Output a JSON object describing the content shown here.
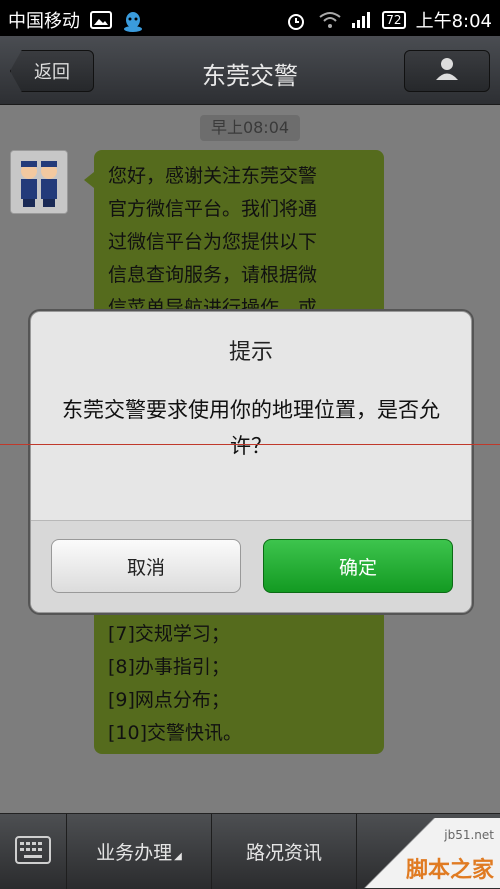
{
  "status_bar": {
    "carrier": "中国移动",
    "icons_left": [
      "image-icon",
      "qq-icon"
    ],
    "icons_right": [
      "alarm-icon",
      "wifi-icon",
      "signal-icon"
    ],
    "battery": "72",
    "time": "上午8:04"
  },
  "title_bar": {
    "back_label": "返回",
    "title": "东莞交警",
    "profile_icon": "person-icon"
  },
  "chat": {
    "timestamp": "早上08:04",
    "message_lines": [
      "您好，感谢关注东莞交警",
      "官方微信平台。我们将通",
      "过微信平台为您提供以下",
      "信息查询服务，请根据微",
      "信菜单导航进行操作，或"
    ],
    "message_tail": [
      "[7]交规学习；",
      "[8]办事指引；",
      "[9]网点分布；",
      "[10]交警快讯。"
    ]
  },
  "dialog": {
    "title": "提示",
    "message": "东莞交警要求使用你的地理位置，是否允许？",
    "cancel_label": "取消",
    "ok_label": "确定",
    "ok_color": "#1fa82c"
  },
  "bottom_menu": {
    "keyboard_icon": "keyboard-icon",
    "items": [
      "业务办理",
      "路况资讯"
    ]
  },
  "watermark": {
    "site": "jb51.net",
    "text": "脚本之家"
  }
}
